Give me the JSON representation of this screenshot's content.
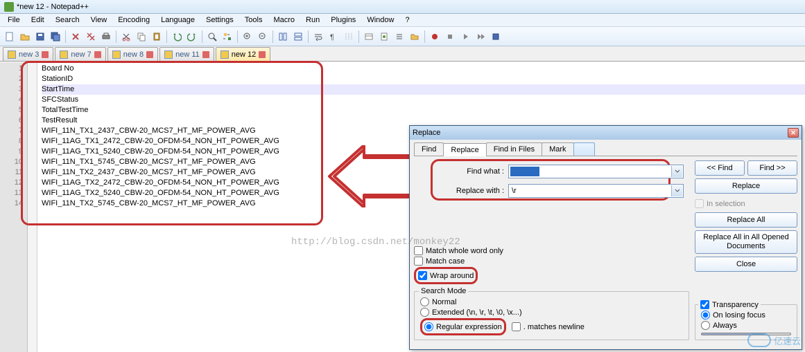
{
  "window": {
    "title": "*new 12 - Notepad++"
  },
  "menu": [
    "File",
    "Edit",
    "Search",
    "View",
    "Encoding",
    "Language",
    "Settings",
    "Tools",
    "Macro",
    "Run",
    "Plugins",
    "Window",
    "?"
  ],
  "tabs": [
    {
      "label": "new 3",
      "dirty": true
    },
    {
      "label": "new 7",
      "dirty": true
    },
    {
      "label": "new 8",
      "dirty": true
    },
    {
      "label": "new 11",
      "dirty": true
    },
    {
      "label": "new 12",
      "dirty": true,
      "active": true
    }
  ],
  "editor": {
    "current_line": 3,
    "lines": [
      "Board No",
      "StationID",
      "StartTime",
      "SFCStatus",
      "TotalTestTime",
      "TestResult",
      "WIFI_11N_TX1_2437_CBW-20_MCS7_HT_MF_POWER_AVG",
      "WIFI_11AG_TX1_2472_CBW-20_OFDM-54_NON_HT_POWER_AVG",
      "WIFI_11AG_TX1_5240_CBW-20_OFDM-54_NON_HT_POWER_AVG",
      "WIFI_11N_TX1_5745_CBW-20_MCS7_HT_MF_POWER_AVG",
      "WIFI_11N_TX2_2437_CBW-20_MCS7_HT_MF_POWER_AVG",
      "WIFI_11AG_TX2_2472_CBW-20_OFDM-54_NON_HT_POWER_AVG",
      "WIFI_11AG_TX2_5240_CBW-20_OFDM-54_NON_HT_POWER_AVG",
      "WIFI_11N_TX2_5745_CBW-20_MCS7_HT_MF_POWER_AVG"
    ]
  },
  "dialog": {
    "title": "Replace",
    "tabs": {
      "find": "Find",
      "replace": "Replace",
      "find_in_files": "Find in Files",
      "mark": "Mark"
    },
    "find_label": "Find what :",
    "find_value": "",
    "replace_label": "Replace with :",
    "replace_value": "\\r",
    "buttons": {
      "find_prev": "<< Find",
      "find_next": "Find >>",
      "replace": "Replace",
      "replace_all": "Replace All",
      "replace_all_open": "Replace All in All Opened Documents",
      "close": "Close"
    },
    "in_selection": "In selection",
    "match_whole": "Match whole word only",
    "match_case": "Match case",
    "wrap_around": "Wrap around",
    "search_mode_label": "Search Mode",
    "mode_normal": "Normal",
    "mode_extended": "Extended (\\n, \\r, \\t, \\0, \\x...)",
    "mode_regex": "Regular expression",
    "matches_newline": ". matches newline",
    "transparency": "Transparency",
    "trans_on_losing": "On losing focus",
    "trans_always": "Always"
  },
  "watermark": "http://blog.csdn.net/monkey22",
  "brand": "亿速云"
}
